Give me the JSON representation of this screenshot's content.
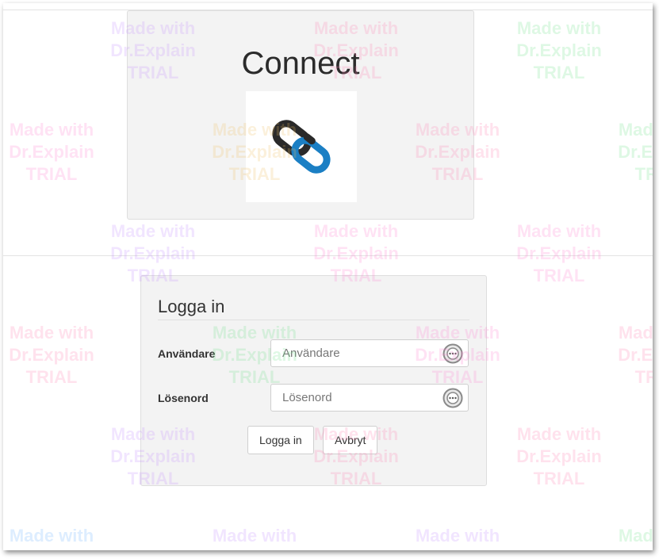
{
  "header": {
    "title": "Connect",
    "logo_icon": "chain-link-icon",
    "logo_colors": {
      "dark": "#2a2a2a",
      "blue": "#1b7fc4"
    }
  },
  "login": {
    "heading": "Logga in",
    "username_label": "Användare",
    "username_placeholder": "Användare",
    "password_label": "Lösenord",
    "password_placeholder": "Lösenord",
    "login_button": "Logga in",
    "cancel_button": "Avbryt",
    "field_icon": "password-manager-icon"
  },
  "watermark": {
    "line1": "Made with",
    "line2": "Dr.Explain",
    "line3": "TRIAL"
  }
}
